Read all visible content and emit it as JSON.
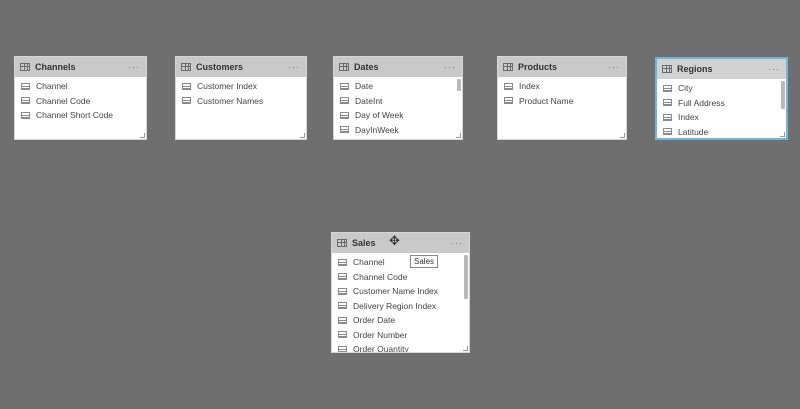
{
  "tables": {
    "channels": {
      "title": "Channels",
      "more": "···",
      "fields": [
        "Channel",
        "Channel Code",
        "Channel Short Code"
      ]
    },
    "customers": {
      "title": "Customers",
      "more": "···",
      "fields": [
        "Customer Index",
        "Customer Names"
      ]
    },
    "dates": {
      "title": "Dates",
      "more": "···",
      "fields": [
        "Date",
        "DateInt",
        "Day of Week",
        "DayInWeek"
      ]
    },
    "products": {
      "title": "Products",
      "more": "···",
      "fields": [
        "Index",
        "Product Name"
      ]
    },
    "regions": {
      "title": "Regions",
      "more": "···",
      "fields": [
        "City",
        "Full Address",
        "Index",
        "Latitude"
      ]
    },
    "sales": {
      "title": "Sales",
      "more": "···",
      "fields": [
        "Channel",
        "Channel Code",
        "Customer Name Index",
        "Delivery Region Index",
        "Order Date",
        "Order Number",
        "Order Quantity"
      ]
    }
  },
  "tooltip": {
    "text": "Sales"
  },
  "colors": {
    "canvas": "#6f6f6f",
    "selected_border": "#6fb7dd",
    "header": "#c9c9c9"
  },
  "icons": {
    "table": "table-icon",
    "field": "field-icon",
    "more": "more-options-icon",
    "cursor": "move-cursor-icon"
  }
}
